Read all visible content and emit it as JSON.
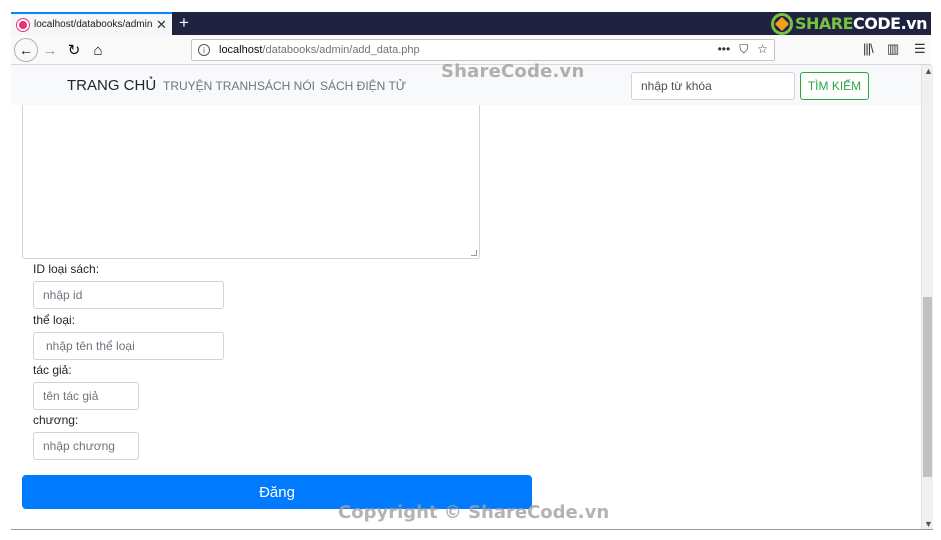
{
  "browser": {
    "tab": {
      "title": "localhost/databooks/admin/add_data.php",
      "close": "✕"
    },
    "new_tab": "+",
    "url": {
      "host": "localhost",
      "path": "/databooks/admin/add_data.php"
    },
    "url_actions": {
      "more": "•••",
      "pocket": "⛉",
      "bookmark": "☆"
    },
    "toolbar": {
      "back": "←",
      "forward": "→",
      "reload": "↻",
      "home": "⌂",
      "library": "|||\\",
      "sidebar": "▥",
      "menu": "☰"
    },
    "scroll": {
      "up": "▲",
      "down": "▼",
      "thumb_position_fraction": 0.78
    },
    "logo": {
      "text_green": "SHARE",
      "text_white": "CODE.vn"
    }
  },
  "site": {
    "brand": "TRANG CHỦ",
    "nav": [
      "TRUYỆN TRANH",
      "SÁCH NÓI",
      "SÁCH ĐIỆN TỬ"
    ],
    "search": {
      "placeholder": "nhập từ khóa",
      "button": "TÌM KIẾM"
    }
  },
  "form": {
    "fields": [
      {
        "label": "ID loại sách:",
        "placeholder": "nhập id"
      },
      {
        "label": "thể loại:",
        "placeholder": "nhập tên thể loại"
      },
      {
        "label": "tác giả:",
        "placeholder": "tên tác giả"
      },
      {
        "label": "chương:",
        "placeholder": "nhập chương"
      }
    ],
    "submit": "Đăng"
  },
  "watermarks": {
    "top": "ShareCode.vn",
    "bottom": "Copyright © ShareCode.vn"
  },
  "colors": {
    "primary": "#007bff",
    "success": "#28a745",
    "tab_strip": "#1f2340",
    "logo_green": "#79c142"
  }
}
